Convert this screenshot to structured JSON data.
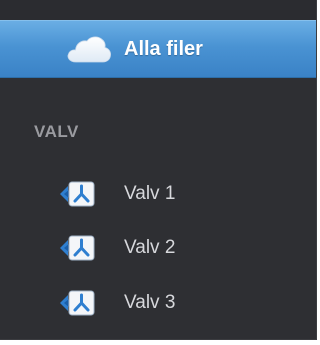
{
  "all_files": {
    "label": "Alla filer",
    "icon": "cloud-icon"
  },
  "vaults": {
    "heading": "VALV",
    "items": [
      {
        "label": "Valv 1",
        "icon": "vault-icon"
      },
      {
        "label": "Valv 2",
        "icon": "vault-icon"
      },
      {
        "label": "Valv 3",
        "icon": "vault-icon"
      }
    ]
  },
  "colors": {
    "panel_background": "#2e2f33",
    "highlight_blue": "#4a93d3",
    "heading_gray": "#9a9ba0",
    "item_text": "#d7d8dc",
    "icon_blue": "#2f7fd0"
  }
}
